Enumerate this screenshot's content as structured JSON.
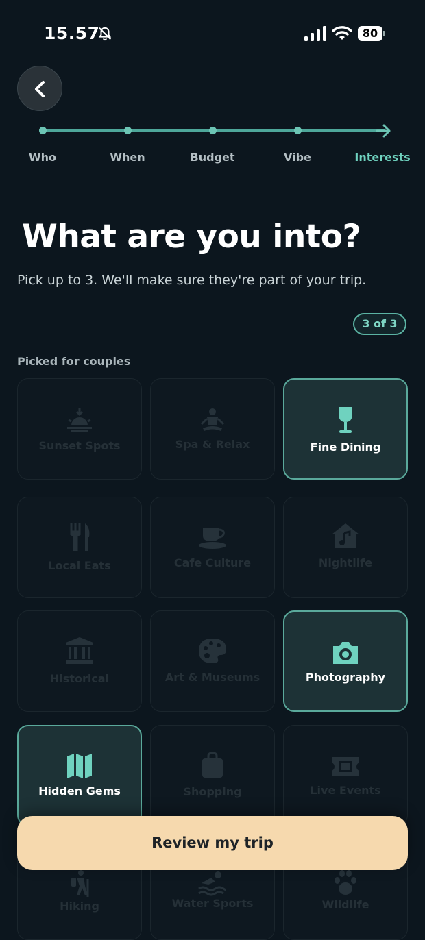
{
  "status": {
    "time": "15.57",
    "battery": "80"
  },
  "steps": [
    {
      "label": "Who"
    },
    {
      "label": "When"
    },
    {
      "label": "Budget"
    },
    {
      "label": "Vibe"
    },
    {
      "label": "Interests"
    }
  ],
  "title": "What are you into?",
  "subtitle": "Pick up to 3. We'll make sure they're part of your trip.",
  "counter": "3 of 3",
  "section_label": "Picked for couples",
  "interests": [
    {
      "label": "Sunset Spots",
      "icon": "sunset-icon",
      "selected": false
    },
    {
      "label": "Spa & Relax",
      "icon": "meditation-icon",
      "selected": false
    },
    {
      "label": "Fine Dining",
      "icon": "wine-glass-icon",
      "selected": true
    },
    {
      "label": "Local Eats",
      "icon": "utensils-icon",
      "selected": false
    },
    {
      "label": "Cafe Culture",
      "icon": "coffee-cup-icon",
      "selected": false
    },
    {
      "label": "Nightlife",
      "icon": "music-house-icon",
      "selected": false
    },
    {
      "label": "Historical",
      "icon": "landmark-icon",
      "selected": false
    },
    {
      "label": "Art & Museums",
      "icon": "palette-icon",
      "selected": false
    },
    {
      "label": "Photography",
      "icon": "camera-icon",
      "selected": true
    },
    {
      "label": "Hidden Gems",
      "icon": "map-icon",
      "selected": true
    },
    {
      "label": "Shopping",
      "icon": "shopping-bag-icon",
      "selected": false
    },
    {
      "label": "Live Events",
      "icon": "ticket-icon",
      "selected": false
    },
    {
      "label": "Hiking",
      "icon": "hiking-icon",
      "selected": false
    },
    {
      "label": "Water Sports",
      "icon": "swimmer-icon",
      "selected": false
    },
    {
      "label": "Wildlife",
      "icon": "paw-icon",
      "selected": false
    }
  ],
  "cta": "Review my trip",
  "colors": {
    "accent": "#6fd2bf",
    "background": "#0c161e",
    "cta": "#f6d9ae"
  }
}
